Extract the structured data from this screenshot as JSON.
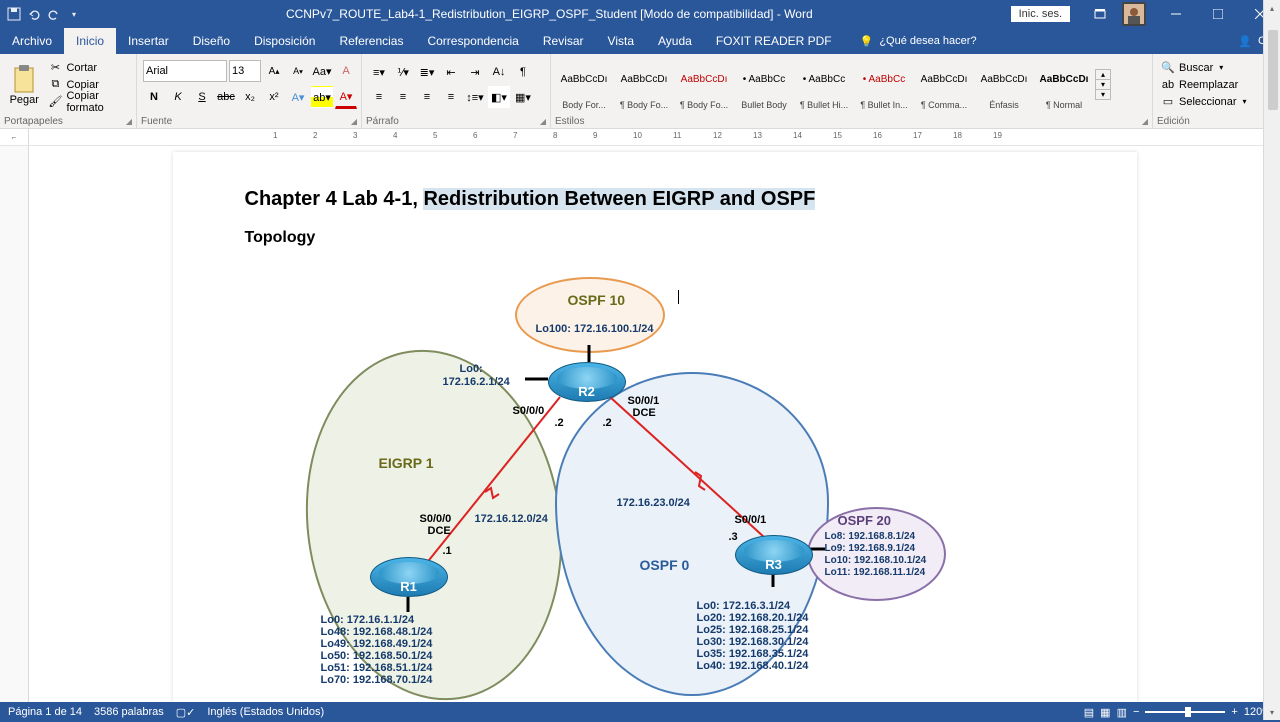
{
  "title": "CCNPv7_ROUTE_Lab4-1_Redistribution_EIGRP_OSPF_Student [Modo de compatibilidad] - Word",
  "signin": "Inic. ses.",
  "share": "Co",
  "menu": {
    "file": "Archivo",
    "home": "Inicio",
    "insert": "Insertar",
    "design": "Diseño",
    "layout": "Disposición",
    "refs": "Referencias",
    "mail": "Correspondencia",
    "review": "Revisar",
    "view": "Vista",
    "help": "Ayuda",
    "foxit": "FOXIT READER PDF"
  },
  "tellme_placeholder": "¿Qué desea hacer?",
  "clipboard": {
    "paste": "Pegar",
    "cut": "Cortar",
    "copy": "Copiar",
    "formatpainter": "Copiar formato",
    "label": "Portapapeles"
  },
  "font": {
    "name": "Arial",
    "size": "13",
    "label": "Fuente",
    "bold": "N",
    "italic": "K",
    "underline": "S"
  },
  "para": {
    "label": "Párrafo"
  },
  "styles": {
    "label": "Estilos",
    "items": [
      {
        "preview": "AaBbCcDı",
        "name": "Body For..."
      },
      {
        "preview": "AaBbCcDı",
        "name": "¶ Body Fo..."
      },
      {
        "preview": "AaBbCcDı",
        "name": "¶ Body Fo...",
        "color": "#c00000"
      },
      {
        "preview": "• AaBbCc",
        "name": "Bullet Body"
      },
      {
        "preview": "• AaBbCc",
        "name": "¶ Bullet Hi..."
      },
      {
        "preview": "• AaBbCc",
        "name": "¶ Bullet In...",
        "color": "#c00000"
      },
      {
        "preview": "AaBbCcDı",
        "name": "¶ Comma..."
      },
      {
        "preview": "AaBbCcDı",
        "name": "Énfasis"
      },
      {
        "preview": "AaBbCcDı",
        "name": "¶ Normal",
        "bold": true
      }
    ]
  },
  "editing": {
    "find": "Buscar",
    "replace": "Reemplazar",
    "select": "Seleccionar",
    "label": "Edición"
  },
  "ruler_nums": [
    "1",
    "2",
    "3",
    "4",
    "5",
    "6",
    "7",
    "8",
    "9",
    "10",
    "11",
    "12",
    "13",
    "14",
    "15",
    "16",
    "17",
    "18",
    "19"
  ],
  "doc": {
    "h1a": "Chapter 4 Lab 4-1, ",
    "h1b": "Redistribution Between EIGRP and OSPF",
    "topology": "Topology",
    "ospf10": "OSPF 10",
    "lo100": "Lo100:  172.16.100.1/24",
    "eigrp": "EIGRP 1",
    "ospf0": "OSPF 0",
    "ospf20": "OSPF 20",
    "r1": "R1",
    "r2": "R2",
    "r3": "R3",
    "lo0_r2_a": "Lo0:",
    "lo0_r2_b": "172.16.2.1/24",
    "s000": "S0/0/0",
    "s001": "S0/0/1",
    "dce": "DCE",
    "dot1": ".1",
    "dot2": ".2",
    "dot3": ".3",
    "net12": "172.16.12.0/24",
    "net23": "172.16.23.0/24",
    "r1loops": [
      "Lo0:  172.16.1.1/24",
      "Lo48: 192.168.48.1/24",
      "Lo49: 192.168.49.1/24",
      "Lo50: 192.168.50.1/24",
      "Lo51: 192.168.51.1/24",
      "Lo70: 192.168.70.1/24"
    ],
    "r3loopsA": [
      "Lo0: 172.16.3.1/24",
      "Lo20: 192.168.20.1/24",
      "Lo25: 192.168.25.1/24",
      "Lo30: 192.168.30.1/24",
      "Lo35: 192.168.35.1/24",
      "Lo40: 192.168.40.1/24"
    ],
    "r3loopsB": [
      "Lo8: 192.168.8.1/24",
      "Lo9: 192.168.9.1/24",
      "Lo10: 192.168.10.1/24",
      "Lo11: 192.168.11.1/24"
    ]
  },
  "status": {
    "page": "Página 1 de 14",
    "words": "3586 palabras",
    "lang": "Inglés (Estados Unidos)",
    "zoom": "120%"
  }
}
